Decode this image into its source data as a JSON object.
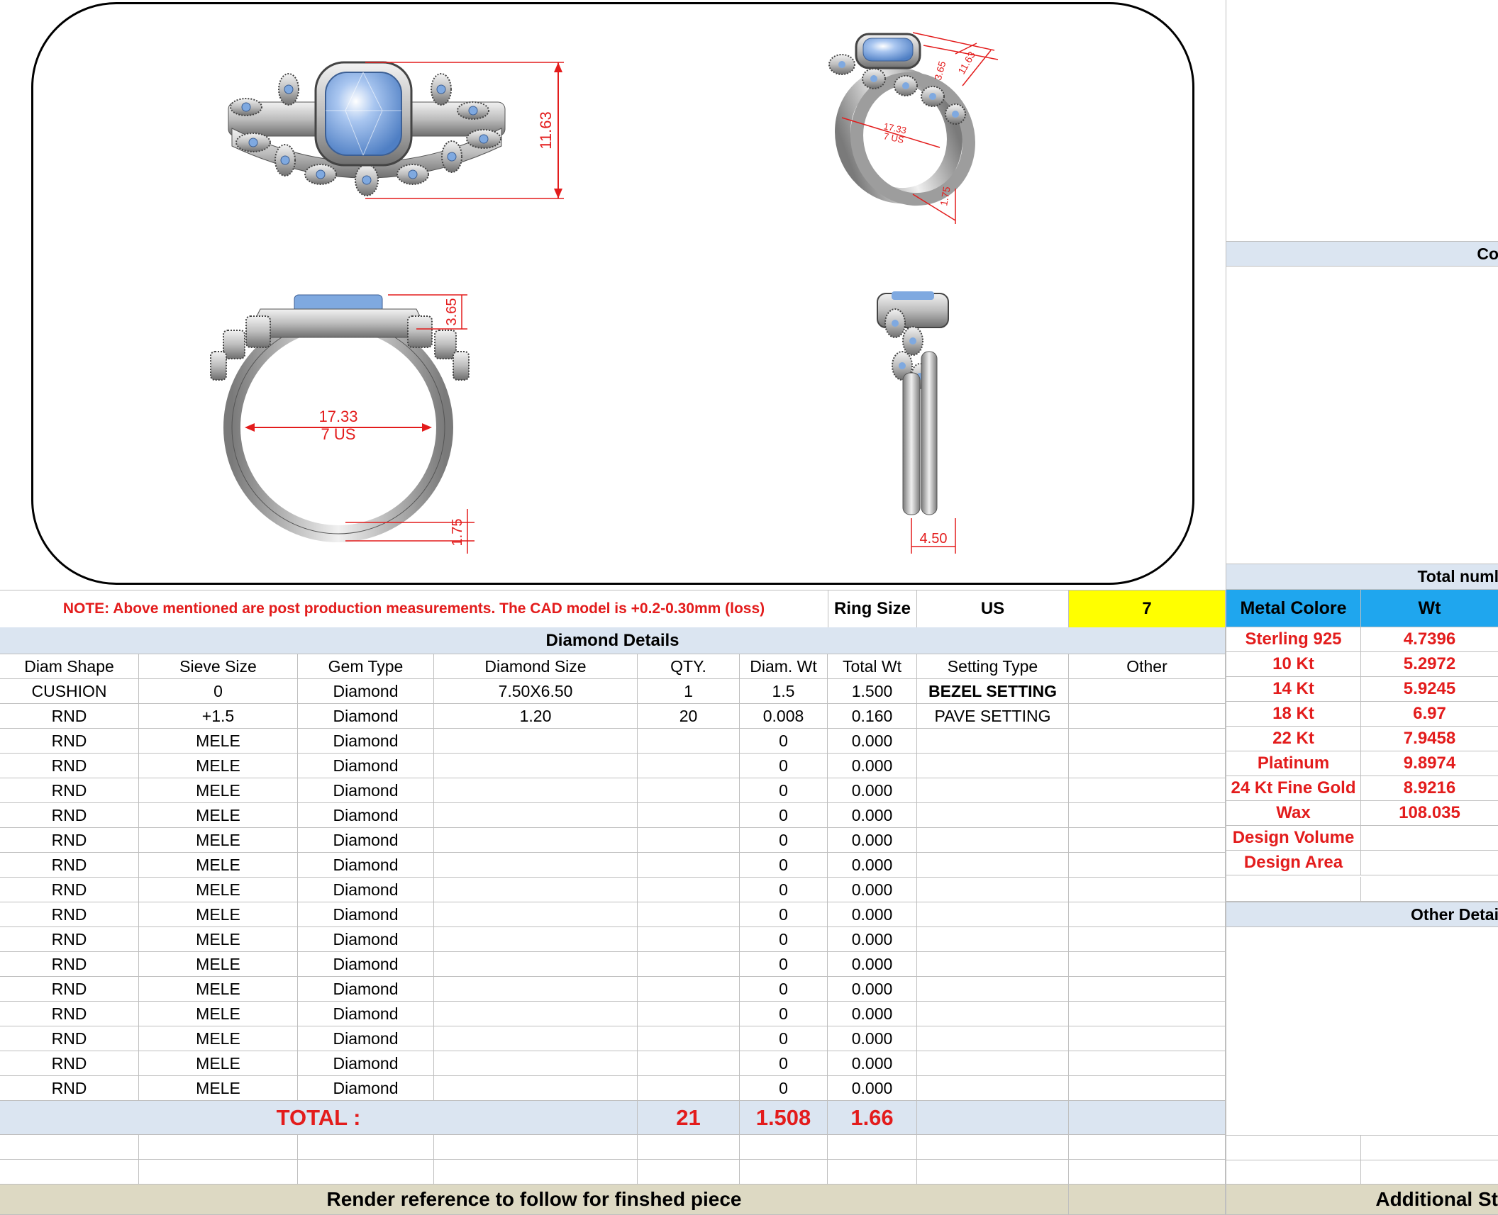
{
  "render": {
    "dim_top_height": "11.63",
    "dim_front_inner": "17.33",
    "dim_front_size": "7 US",
    "dim_front_top": "3.65",
    "dim_front_bottom": "1.75",
    "dim_side_width": "4.50",
    "dim_persp_a": "3.65",
    "dim_persp_b": "11.63",
    "dim_persp_inner": "17.33",
    "dim_persp_size": "7 US",
    "dim_persp_c": "1.75"
  },
  "note": {
    "text": "NOTE: Above mentioned are post production measurements. The CAD model is +0.2-0.30mm (loss)",
    "ring_size_label": "Ring Size",
    "ring_size_unit": "US",
    "ring_size_value": "7"
  },
  "diamond": {
    "section_title": "Diamond Details",
    "headers": [
      "Diam Shape",
      "Sieve Size",
      "Gem Type",
      "Diamond Size",
      "QTY.",
      "Diam. Wt",
      "Total Wt",
      "Setting Type",
      "Other"
    ],
    "rows": [
      [
        "CUSHION",
        "0",
        "Diamond",
        "7.50X6.50",
        "1",
        "1.5",
        "1.500",
        "BEZEL SETTING",
        ""
      ],
      [
        "RND",
        "+1.5",
        "Diamond",
        "1.20",
        "20",
        "0.008",
        "0.160",
        "PAVE SETTING",
        ""
      ],
      [
        "RND",
        "MELE",
        "Diamond",
        "",
        "",
        "0",
        "0.000",
        "",
        ""
      ],
      [
        "RND",
        "MELE",
        "Diamond",
        "",
        "",
        "0",
        "0.000",
        "",
        ""
      ],
      [
        "RND",
        "MELE",
        "Diamond",
        "",
        "",
        "0",
        "0.000",
        "",
        ""
      ],
      [
        "RND",
        "MELE",
        "Diamond",
        "",
        "",
        "0",
        "0.000",
        "",
        ""
      ],
      [
        "RND",
        "MELE",
        "Diamond",
        "",
        "",
        "0",
        "0.000",
        "",
        ""
      ],
      [
        "RND",
        "MELE",
        "Diamond",
        "",
        "",
        "0",
        "0.000",
        "",
        ""
      ],
      [
        "RND",
        "MELE",
        "Diamond",
        "",
        "",
        "0",
        "0.000",
        "",
        ""
      ],
      [
        "RND",
        "MELE",
        "Diamond",
        "",
        "",
        "0",
        "0.000",
        "",
        ""
      ],
      [
        "RND",
        "MELE",
        "Diamond",
        "",
        "",
        "0",
        "0.000",
        "",
        ""
      ],
      [
        "RND",
        "MELE",
        "Diamond",
        "",
        "",
        "0",
        "0.000",
        "",
        ""
      ],
      [
        "RND",
        "MELE",
        "Diamond",
        "",
        "",
        "0",
        "0.000",
        "",
        ""
      ],
      [
        "RND",
        "MELE",
        "Diamond",
        "",
        "",
        "0",
        "0.000",
        "",
        ""
      ],
      [
        "RND",
        "MELE",
        "Diamond",
        "",
        "",
        "0",
        "0.000",
        "",
        ""
      ],
      [
        "RND",
        "MELE",
        "Diamond",
        "",
        "",
        "0",
        "0.000",
        "",
        ""
      ],
      [
        "RND",
        "MELE",
        "Diamond",
        "",
        "",
        "0",
        "0.000",
        "",
        ""
      ]
    ],
    "total_label": "TOTAL :",
    "total_qty": "21",
    "total_diam_wt": "1.508",
    "total_wt": "1.66"
  },
  "footer": {
    "render_reference": "Render reference to follow for finshed piece",
    "additional": "Additional St"
  },
  "right": {
    "top_header": "Co",
    "total_header": "Total numl",
    "metal_label": "Metal Colore",
    "wt_label": "Wt",
    "metals": [
      {
        "name": "Sterling 925",
        "wt": "4.7396"
      },
      {
        "name": "10 Kt",
        "wt": "5.2972"
      },
      {
        "name": "14 Kt",
        "wt": "5.9245"
      },
      {
        "name": "18 Kt",
        "wt": "6.97"
      },
      {
        "name": "22 Kt",
        "wt": "7.9458"
      },
      {
        "name": "Platinum",
        "wt": "9.8974"
      },
      {
        "name": "24 Kt Fine Gold",
        "wt": "8.9216"
      },
      {
        "name": "Wax",
        "wt": "108.035"
      },
      {
        "name": "Design Volume",
        "wt": ""
      },
      {
        "name": "Design Area",
        "wt": ""
      }
    ],
    "other_header": "Other Detai"
  },
  "colors": {
    "accent_red": "#e31c1c",
    "header_blue": "#1fa6ee",
    "header_light_blue": "#dbe5f1",
    "ring_size_yellow": "#ffff00",
    "footer_tan": "#ddd9c3",
    "gem_blue": "#7fa9e0"
  }
}
